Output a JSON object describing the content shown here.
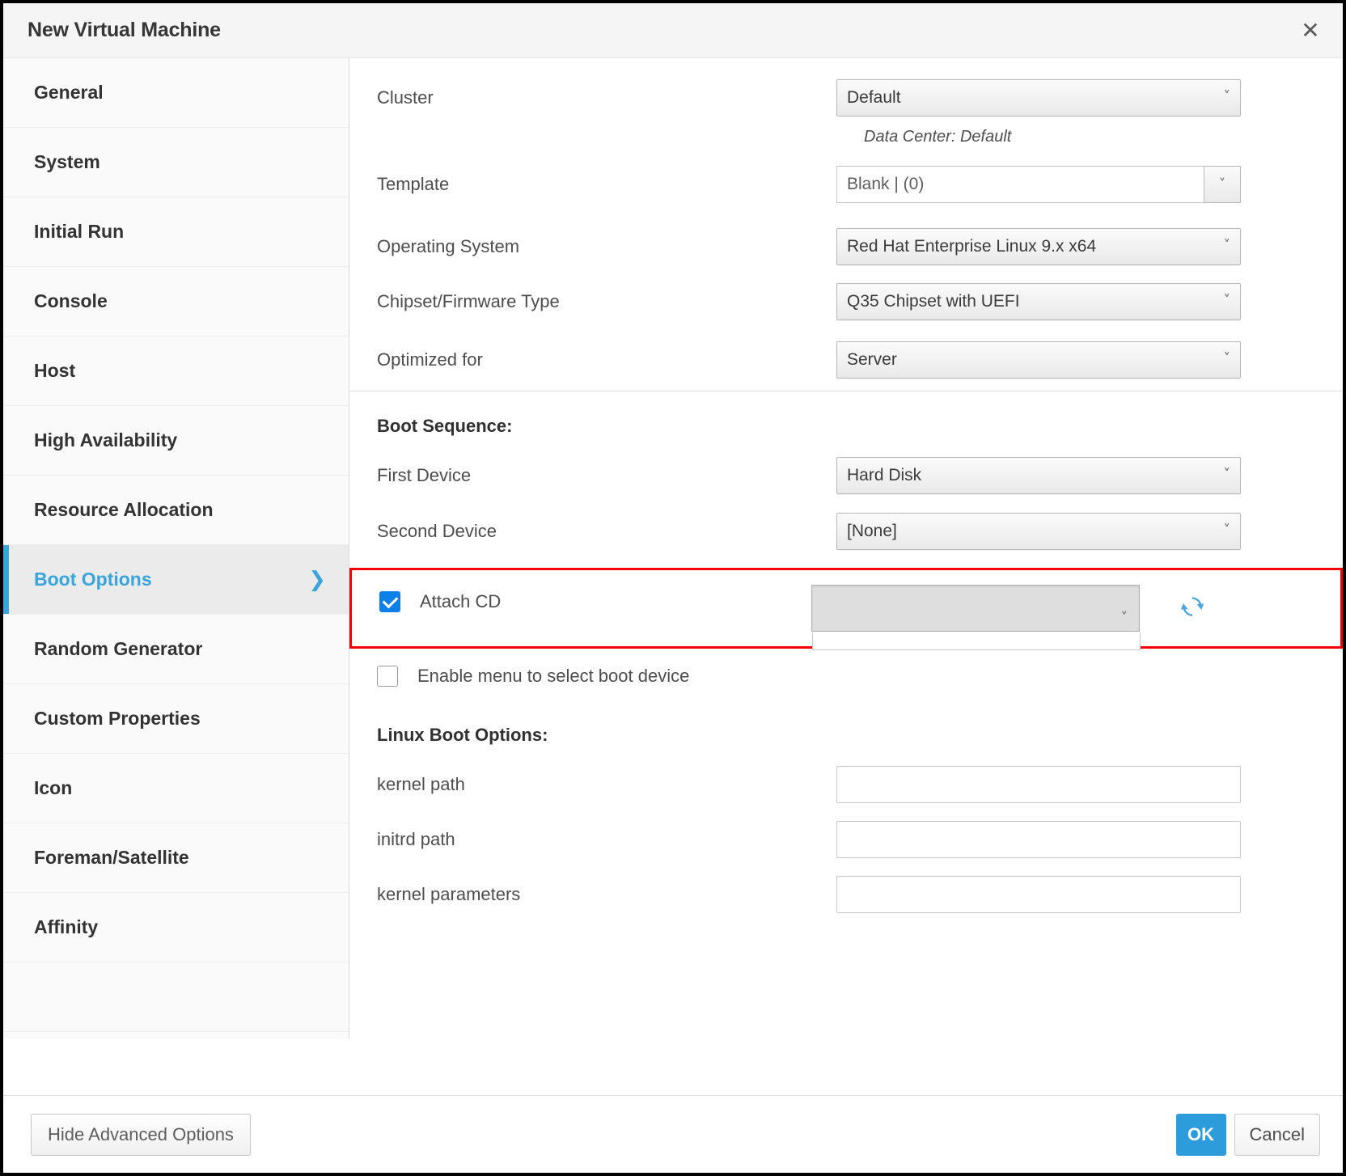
{
  "window": {
    "title": "New Virtual Machine",
    "close_icon": "close-icon"
  },
  "sidebar": {
    "items": [
      {
        "label": "General",
        "active": false
      },
      {
        "label": "System",
        "active": false
      },
      {
        "label": "Initial Run",
        "active": false
      },
      {
        "label": "Console",
        "active": false
      },
      {
        "label": "Host",
        "active": false
      },
      {
        "label": "High Availability",
        "active": false
      },
      {
        "label": "Resource Allocation",
        "active": false
      },
      {
        "label": "Boot Options",
        "active": true
      },
      {
        "label": "Random Generator",
        "active": false
      },
      {
        "label": "Custom Properties",
        "active": false
      },
      {
        "label": "Icon",
        "active": false
      },
      {
        "label": "Foreman/Satellite",
        "active": false
      },
      {
        "label": "Affinity",
        "active": false
      }
    ],
    "active_chevron": "chevron-right-icon",
    "active_accent_color": "#39a5dc"
  },
  "form": {
    "cluster": {
      "label": "Cluster",
      "value": "Default",
      "hint": "Data Center: Default"
    },
    "template": {
      "label": "Template",
      "value": "Blank |  (0)"
    },
    "operating_system": {
      "label": "Operating System",
      "value": "Red Hat Enterprise Linux 9.x x64"
    },
    "chipset": {
      "label": "Chipset/Firmware Type",
      "value": "Q35 Chipset with UEFI"
    },
    "optimized_for": {
      "label": "Optimized for",
      "value": "Server"
    }
  },
  "boot_sequence": {
    "heading": "Boot Sequence:",
    "first_device": {
      "label": "First Device",
      "value": "Hard Disk"
    },
    "second_device": {
      "label": "Second Device",
      "value": "[None]"
    },
    "attach_cd": {
      "label": "Attach CD",
      "checked": true,
      "cd_value": "",
      "refresh_icon": "refresh-icon",
      "highlight_color": "#f50000"
    },
    "enable_menu": {
      "label": "Enable menu to select boot device",
      "checked": false
    }
  },
  "linux_boot_options": {
    "heading": "Linux Boot Options:",
    "kernel_path": {
      "label": "kernel path",
      "value": "",
      "placeholder": ""
    },
    "initrd_path": {
      "label": "initrd path",
      "value": "",
      "placeholder": ""
    },
    "kernel_parameters": {
      "label": "kernel parameters",
      "value": "",
      "placeholder": ""
    }
  },
  "footer": {
    "hide_advanced": "Hide Advanced Options",
    "ok": "OK",
    "cancel": "Cancel",
    "ok_color": "#2d9cdb"
  }
}
